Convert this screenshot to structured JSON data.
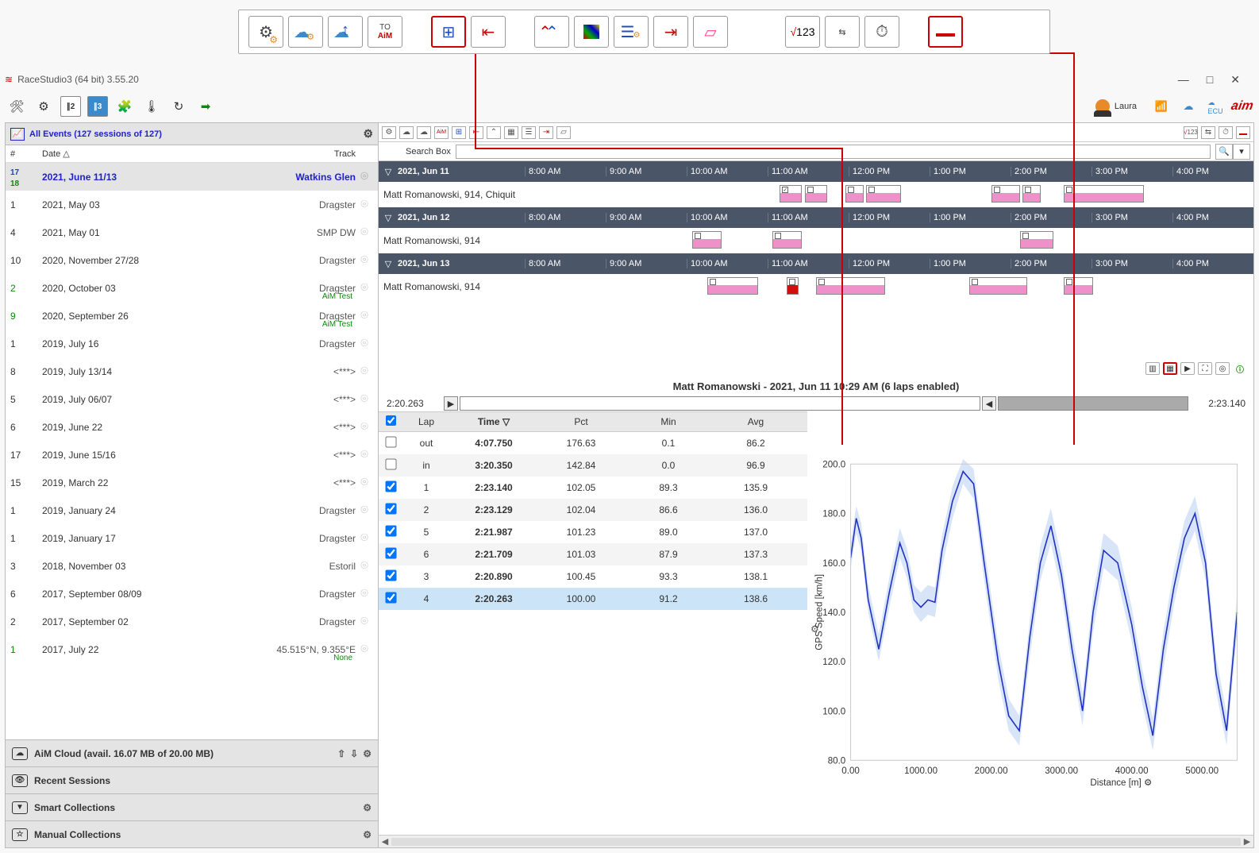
{
  "app_title": "RaceStudio3 (64 bit) 3.55.20",
  "user_name": "Laura",
  "sidebar": {
    "header": "All Events (127 sessions of 127)",
    "col_num": "#",
    "col_date": "Date △",
    "col_track": "Track",
    "rows": [
      {
        "num": "17",
        "num2": "18",
        "date": "2021, June 11/13",
        "track": "Watkins Glen",
        "sel": true
      },
      {
        "num": "1",
        "date": "2021, May 03",
        "track": "Dragster"
      },
      {
        "num": "4",
        "date": "2021, May 01",
        "track": "SMP DW"
      },
      {
        "num": "10",
        "date": "2020, November 27/28",
        "track": "Dragster"
      },
      {
        "num": "2",
        "date": "2020, October 03",
        "track": "Dragster",
        "sub": "AiM Test",
        "grn": true
      },
      {
        "num": "9",
        "date": "2020, September 26",
        "track": "Dragster",
        "sub": "AiM Test",
        "grn": true
      },
      {
        "num": "1",
        "date": "2019, July 16",
        "track": "Dragster"
      },
      {
        "num": "8",
        "date": "2019, July 13/14",
        "track": "<***>"
      },
      {
        "num": "5",
        "date": "2019, July 06/07",
        "track": "<***>"
      },
      {
        "num": "6",
        "date": "2019, June 22",
        "track": "<***>"
      },
      {
        "num": "17",
        "date": "2019, June 15/16",
        "track": "<***>"
      },
      {
        "num": "15",
        "date": "2019, March 22",
        "track": "<***>"
      },
      {
        "num": "1",
        "date": "2019, January 24",
        "track": "Dragster"
      },
      {
        "num": "1",
        "date": "2019, January 17",
        "track": "Dragster"
      },
      {
        "num": "3",
        "date": "2018, November 03",
        "track": "Estoril"
      },
      {
        "num": "6",
        "date": "2017, September 08/09",
        "track": "Dragster"
      },
      {
        "num": "2",
        "date": "2017, September 02",
        "track": "Dragster"
      },
      {
        "num": "1",
        "date": "2017, July 22",
        "track": "45.515°N, 9.355°E",
        "sub": "None",
        "grn": true
      }
    ],
    "cloud_bar": "AiM Cloud (avail. 16.07 MB of 20.00 MB)",
    "recent": "Recent Sessions",
    "smart": "Smart Collections",
    "manual": "Manual Collections"
  },
  "timeline": {
    "hours": [
      "8:00 AM",
      "9:00 AM",
      "10:00 AM",
      "11:00 AM",
      "12:00 PM",
      "1:00 PM",
      "2:00 PM",
      "3:00 PM",
      "4:00 PM"
    ],
    "days": [
      {
        "date": "2021, Jun 11",
        "label": "Matt Romanowski, 914, Chiquit",
        "segs": [
          {
            "l": 35,
            "w": 3,
            "c": true
          },
          {
            "l": 38.5,
            "w": 3
          },
          {
            "l": 44,
            "w": 2.5
          },
          {
            "l": 46.8,
            "w": 4.8
          },
          {
            "l": 64,
            "w": 4
          },
          {
            "l": 68.3,
            "w": 2.5
          },
          {
            "l": 74,
            "w": 11
          }
        ]
      },
      {
        "date": "2021, Jun 12",
        "label": "Matt Romanowski, 914",
        "segs": [
          {
            "l": 23,
            "w": 4
          },
          {
            "l": 34,
            "w": 4
          },
          {
            "l": 68,
            "w": 4.5
          }
        ]
      },
      {
        "date": "2021, Jun 13",
        "label": "Matt Romanowski, 914",
        "segs": [
          {
            "l": 25,
            "w": 7
          },
          {
            "l": 36,
            "w": 1.6,
            "red": true
          },
          {
            "l": 40,
            "w": 9.5
          },
          {
            "l": 61,
            "w": 8
          },
          {
            "l": 74,
            "w": 4
          }
        ]
      }
    ],
    "search_label": "Search Box"
  },
  "session_title": "Matt Romanowski - 2021, Jun 11 10:29 AM (6 laps enabled)",
  "slider_left": "2:20.263",
  "slider_right": "2:23.140",
  "lap_table": {
    "cols": {
      "lap": "Lap",
      "time": "Time ▽",
      "pct": "Pct",
      "min": "Min",
      "avg": "Avg"
    },
    "rows": [
      {
        "chk": false,
        "lap": "out",
        "time": "4:07.750",
        "pct": "176.63",
        "min": "0.1",
        "avg": "86.2"
      },
      {
        "chk": false,
        "lap": "in",
        "time": "3:20.350",
        "pct": "142.84",
        "min": "0.0",
        "avg": "96.9"
      },
      {
        "chk": true,
        "lap": "1",
        "time": "2:23.140",
        "pct": "102.05",
        "min": "89.3",
        "avg": "135.9"
      },
      {
        "chk": true,
        "lap": "2",
        "time": "2:23.129",
        "pct": "102.04",
        "min": "86.6",
        "avg": "136.0"
      },
      {
        "chk": true,
        "lap": "5",
        "time": "2:21.987",
        "pct": "101.23",
        "min": "89.0",
        "avg": "137.0"
      },
      {
        "chk": true,
        "lap": "6",
        "time": "2:21.709",
        "pct": "101.03",
        "min": "87.9",
        "avg": "137.3"
      },
      {
        "chk": true,
        "lap": "3",
        "time": "2:20.890",
        "pct": "100.45",
        "min": "93.3",
        "avg": "138.1"
      },
      {
        "chk": true,
        "lap": "4",
        "time": "2:20.263",
        "pct": "100.00",
        "min": "91.2",
        "avg": "138.6",
        "hl": true
      }
    ]
  },
  "chart_data": {
    "type": "line",
    "title": "",
    "xlabel": "Distance [m]",
    "ylabel": "GPS Speed [km/h]",
    "xlim": [
      0,
      5500
    ],
    "ylim": [
      80,
      200
    ],
    "xticks": [
      0,
      1000,
      2000,
      3000,
      4000,
      5000
    ],
    "yticks": [
      80,
      100,
      120,
      140,
      160,
      180,
      200
    ],
    "x": [
      0,
      80,
      150,
      250,
      400,
      550,
      700,
      800,
      900,
      1000,
      1100,
      1200,
      1300,
      1450,
      1600,
      1750,
      1900,
      2100,
      2250,
      2400,
      2550,
      2700,
      2850,
      3000,
      3150,
      3300,
      3450,
      3600,
      3800,
      4000,
      4150,
      4300,
      4450,
      4600,
      4750,
      4900,
      5050,
      5200,
      5350,
      5500
    ],
    "values": [
      162,
      178,
      170,
      145,
      125,
      148,
      168,
      160,
      145,
      142,
      145,
      144,
      165,
      185,
      197,
      192,
      160,
      120,
      98,
      92,
      130,
      160,
      175,
      155,
      125,
      100,
      140,
      165,
      160,
      135,
      110,
      90,
      125,
      150,
      170,
      180,
      160,
      115,
      92,
      140
    ],
    "band_lo": [
      158,
      172,
      165,
      140,
      120,
      142,
      162,
      154,
      140,
      136,
      139,
      138,
      158,
      178,
      192,
      186,
      153,
      113,
      92,
      86,
      122,
      153,
      168,
      148,
      118,
      94,
      132,
      158,
      153,
      128,
      103,
      84,
      117,
      143,
      163,
      173,
      153,
      108,
      86,
      132
    ],
    "band_hi": [
      168,
      183,
      176,
      151,
      131,
      154,
      174,
      166,
      151,
      148,
      151,
      150,
      171,
      191,
      202,
      198,
      167,
      127,
      105,
      98,
      137,
      167,
      182,
      162,
      132,
      107,
      147,
      172,
      167,
      142,
      117,
      97,
      132,
      157,
      177,
      187,
      167,
      122,
      99,
      147
    ]
  }
}
